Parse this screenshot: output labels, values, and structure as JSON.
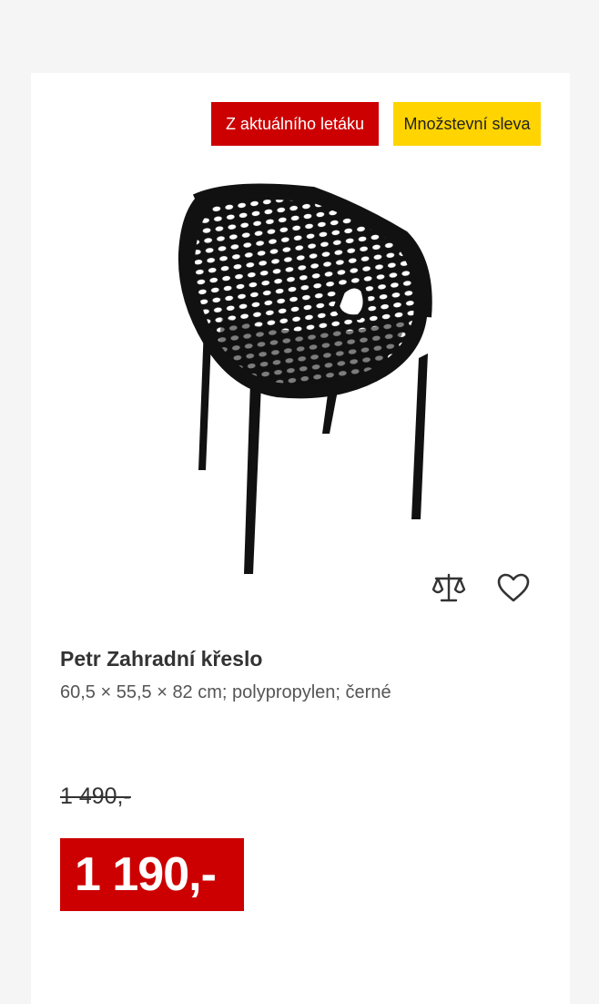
{
  "badges": {
    "flyer": "Z aktuálního letáku",
    "quantity_discount": "Množstevní sleva"
  },
  "product": {
    "image_icon": "chair-image",
    "name": "Petr Zahradní křeslo",
    "description": "60,5 × 55,5 × 82 cm; polypropylen; černé",
    "old_price": "1 490,-",
    "price": "1 190,-"
  },
  "actions": {
    "compare_icon": "scale-icon",
    "wishlist_icon": "heart-icon"
  },
  "colors": {
    "accent_red": "#cc0000",
    "badge_yellow": "#ffd400"
  }
}
